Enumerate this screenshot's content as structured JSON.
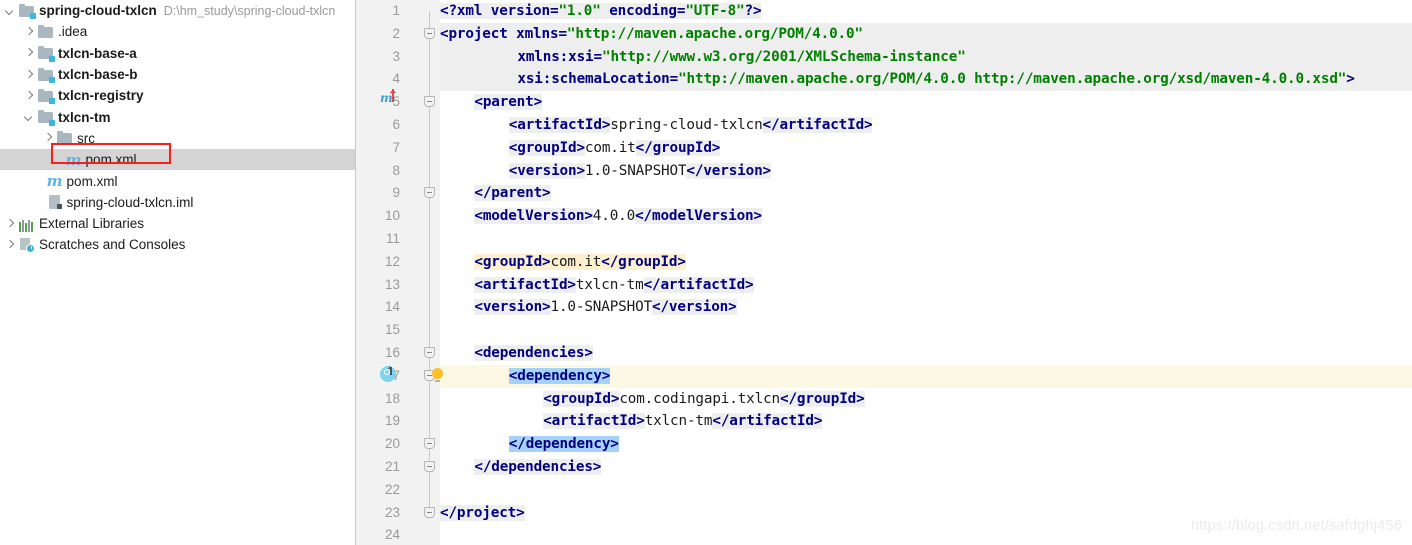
{
  "project_tree": {
    "name": "project-tree",
    "items": [
      {
        "label": "spring-cloud-txlcn",
        "path": "D:\\hm_study\\spring-cloud-txlcn",
        "icon": "module-folder-icon",
        "indent": 0,
        "arrow": "down",
        "bold": true,
        "selected": false
      },
      {
        "label": ".idea",
        "path": "",
        "icon": "folder-icon",
        "indent": 1,
        "arrow": "right",
        "bold": false,
        "selected": false
      },
      {
        "label": "txlcn-base-a",
        "path": "",
        "icon": "module-folder-icon",
        "indent": 1,
        "arrow": "right",
        "bold": true,
        "selected": false
      },
      {
        "label": "txlcn-base-b",
        "path": "",
        "icon": "module-folder-icon",
        "indent": 1,
        "arrow": "right",
        "bold": true,
        "selected": false
      },
      {
        "label": "txlcn-registry",
        "path": "",
        "icon": "module-folder-icon",
        "indent": 1,
        "arrow": "right",
        "bold": true,
        "selected": false
      },
      {
        "label": "txlcn-tm",
        "path": "",
        "icon": "module-folder-icon",
        "indent": 1,
        "arrow": "down",
        "bold": true,
        "selected": false
      },
      {
        "label": "src",
        "path": "",
        "icon": "folder-icon",
        "indent": 2,
        "arrow": "right",
        "bold": false,
        "selected": false
      },
      {
        "label": "pom.xml",
        "path": "",
        "icon": "maven-file-icon",
        "indent": 2.45,
        "arrow": "none",
        "bold": false,
        "selected": true
      },
      {
        "label": "pom.xml",
        "path": "",
        "icon": "maven-file-icon",
        "indent": 1.45,
        "arrow": "none",
        "bold": false,
        "selected": false
      },
      {
        "label": "spring-cloud-txlcn.iml",
        "path": "",
        "icon": "iml-file-icon",
        "indent": 1.45,
        "arrow": "none",
        "bold": false,
        "selected": false
      },
      {
        "label": "External Libraries",
        "path": "",
        "icon": "external-libraries-icon",
        "indent": 0,
        "arrow": "right",
        "bold": false,
        "selected": false
      },
      {
        "label": "Scratches and Consoles",
        "path": "",
        "icon": "scratches-icon",
        "indent": 0,
        "arrow": "right",
        "bold": false,
        "selected": false
      }
    ],
    "highlight_box": {
      "color": "#f91e18",
      "target": "pom.xml"
    }
  },
  "editor": {
    "name": "xml-code-editor",
    "language": "xml",
    "file": "pom.xml",
    "first_line": 1,
    "last_line": 24,
    "current_line": 17,
    "line_numbers": [
      "1",
      "2",
      "3",
      "4",
      "5",
      "6",
      "7",
      "8",
      "9",
      "10",
      "11",
      "12",
      "13",
      "14",
      "15",
      "16",
      "17",
      "18",
      "19",
      "20",
      "21",
      "22",
      "23",
      "24"
    ],
    "fold_lines": [
      2,
      5,
      9,
      16,
      17,
      20,
      21,
      23
    ],
    "gutter_icons": [
      {
        "line": 5,
        "icon": "maven-parent-icon"
      },
      {
        "line": 17,
        "icon": "override-marker-icon"
      },
      {
        "line": 17,
        "icon": "intention-bulb-icon"
      }
    ],
    "colors": {
      "tag": "#000080",
      "value": "#008000",
      "text": "#1a1a1a",
      "tag_background": "#eeeeee",
      "usage_highlight": "#fcf0cf",
      "selection": "#a6d2fa",
      "current_line": "#fdf8e4",
      "gutter": "#f2f2f2"
    },
    "lines": [
      {
        "n": 1,
        "indent": 0,
        "parts": [
          {
            "t": "tag",
            "s": "<?"
          },
          {
            "t": "attr-in-tag",
            "s": "xml"
          },
          {
            "t": "tagplain",
            "s": " "
          },
          {
            "t": "attrname",
            "s": "version"
          },
          {
            "t": "tagplain",
            "s": "="
          },
          {
            "t": "val",
            "s": "\"1.0\""
          },
          {
            "t": "tagplain",
            "s": " "
          },
          {
            "t": "attrname",
            "s": "encoding"
          },
          {
            "t": "tagplain",
            "s": "="
          },
          {
            "t": "val",
            "s": "\"UTF-8\""
          },
          {
            "t": "tag",
            "s": "?>"
          }
        ]
      },
      {
        "n": 2,
        "indent": 0,
        "text": "<project xmlns=\"http://maven.apache.org/POM/4.0.0\""
      },
      {
        "n": 3,
        "indent": 9,
        "text": "xmlns:xsi=\"http://www.w3.org/2001/XMLSchema-instance\""
      },
      {
        "n": 4,
        "indent": 9,
        "text": "xsi:schemaLocation=\"http://maven.apache.org/POM/4.0.0 http://maven.apache.org/xsd/maven-4.0.0.xsd\">"
      },
      {
        "n": 5,
        "indent": 4,
        "text": "<parent>"
      },
      {
        "n": 6,
        "indent": 8,
        "text": "<artifactId>spring-cloud-txlcn</artifactId>"
      },
      {
        "n": 7,
        "indent": 8,
        "text": "<groupId>com.it</groupId>"
      },
      {
        "n": 8,
        "indent": 8,
        "text": "<version>1.0-SNAPSHOT</version>"
      },
      {
        "n": 9,
        "indent": 4,
        "text": "</parent>"
      },
      {
        "n": 10,
        "indent": 4,
        "text": "<modelVersion>4.0.0</modelVersion>"
      },
      {
        "n": 11,
        "indent": 0,
        "text": ""
      },
      {
        "n": 12,
        "indent": 4,
        "text": "<groupId>com.it</groupId>"
      },
      {
        "n": 13,
        "indent": 4,
        "text": "<artifactId>txlcn-tm</artifactId>"
      },
      {
        "n": 14,
        "indent": 4,
        "text": "<version>1.0-SNAPSHOT</version>"
      },
      {
        "n": 15,
        "indent": 0,
        "text": ""
      },
      {
        "n": 16,
        "indent": 4,
        "text": "<dependencies>"
      },
      {
        "n": 17,
        "indent": 8,
        "text": "<dependency>"
      },
      {
        "n": 18,
        "indent": 12,
        "text": "<groupId>com.codingapi.txlcn</groupId>"
      },
      {
        "n": 19,
        "indent": 12,
        "text": "<artifactId>txlcn-tm</artifactId>"
      },
      {
        "n": 20,
        "indent": 8,
        "text": "</dependency>"
      },
      {
        "n": 21,
        "indent": 4,
        "text": "</dependencies>"
      },
      {
        "n": 22,
        "indent": 0,
        "text": ""
      },
      {
        "n": 23,
        "indent": 0,
        "text": "</project>"
      },
      {
        "n": 24,
        "indent": 0,
        "text": ""
      }
    ],
    "code_tokens": {
      "l1_q_open": "<?",
      "l1_xml": "xml",
      "l1_version_attr": "version",
      "l1_eq1": "=",
      "l1_version_val": "\"1.0\"",
      "l1_encoding_attr": "encoding",
      "l1_eq2": "=",
      "l1_encoding_val": "\"UTF-8\"",
      "l1_q_close": "?>",
      "l2_tag_open": "<project",
      "l2_attr": "xmlns",
      "l2_eq": "=",
      "l2_val": "\"http://maven.apache.org/POM/4.0.0\"",
      "l3_attr": "xmlns:xsi",
      "l3_eq": "=",
      "l3_val": "\"http://www.w3.org/2001/XMLSchema-instance\"",
      "l4_attr": "xsi:schemaLocation",
      "l4_eq": "=",
      "l4_val": "\"http://maven.apache.org/POM/4.0.0 http://maven.apache.org/xsd/maven-4.0.0.xsd\"",
      "l4_close": ">",
      "l5": "<parent>",
      "l6_open": "<artifactId>",
      "l6_text": "spring-cloud-txlcn",
      "l6_close": "</artifactId>",
      "l7_open": "<groupId>",
      "l7_text": "com.it",
      "l7_close": "</groupId>",
      "l8_open": "<version>",
      "l8_text": "1.0-SNAPSHOT",
      "l8_close": "</version>",
      "l9": "</parent>",
      "l10_open": "<modelVersion>",
      "l10_text": "4.0.0",
      "l10_close": "</modelVersion>",
      "l12_open": "<groupId>",
      "l12_text": "com.it",
      "l12_close": "</groupId>",
      "l13_open": "<artifactId>",
      "l13_text": "txlcn-tm",
      "l13_close": "</artifactId>",
      "l14_open": "<version>",
      "l14_text": "1.0-SNAPSHOT",
      "l14_close": "</version>",
      "l16": "<dependencies>",
      "l17": "<dependency>",
      "l18_open": "<groupId>",
      "l18_text": "com.codingapi.txlcn",
      "l18_close": "</groupId>",
      "l19_open": "<artifactId>",
      "l19_text": "txlcn-tm",
      "l19_close": "</artifactId>",
      "l20": "</dependency>",
      "l21": "</dependencies>",
      "l23": "</project>"
    }
  },
  "watermark": {
    "text": "https://blog.csdn.net/safdghj456"
  }
}
